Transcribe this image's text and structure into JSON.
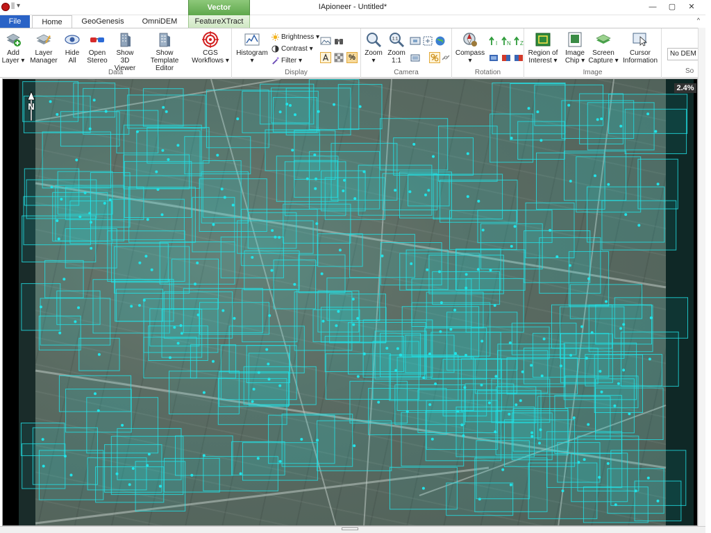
{
  "window": {
    "title": "IApioneer - Untitled*",
    "minimize": "—",
    "maximize": "▢",
    "close": "✕"
  },
  "quick_access": "|| ▾",
  "context_tab_group": "Vector",
  "tabs": [
    {
      "label": "File"
    },
    {
      "label": "Home"
    },
    {
      "label": "GeoGenesis"
    },
    {
      "label": "OmniDEM"
    },
    {
      "label": "FeatureXTract"
    }
  ],
  "ribbon_collapse": "^",
  "groups": {
    "data": {
      "label": "Data",
      "buttons": [
        {
          "l1": "Add",
          "l2": "Layer ▾"
        },
        {
          "l1": "Layer",
          "l2": "Manager"
        },
        {
          "l1": "Hide",
          "l2": "All"
        },
        {
          "l1": "Open",
          "l2": "Stereo"
        },
        {
          "l1": "Show 3D",
          "l2": "Viewer"
        },
        {
          "l1": "Show Template",
          "l2": "Editor"
        },
        {
          "l1": "CGS",
          "l2": "Workflows ▾"
        }
      ]
    },
    "display": {
      "label": "Display",
      "histogram": {
        "l1": "Histogram",
        "l2": "▾"
      },
      "brightness": "Brightness ▾",
      "contrast": "Contrast ▾",
      "filter": "Filter ▾",
      "percent": "%"
    },
    "camera": {
      "label": "Camera",
      "zoom": {
        "l1": "Zoom",
        "l2": "▾"
      },
      "zoom11": {
        "l1": "Zoom",
        "l2": "1:1"
      },
      "zoom11_icon": "1:1"
    },
    "rotation": {
      "label": "Rotation",
      "compass": {
        "l1": "Compass",
        "l2": "▾"
      }
    },
    "image": {
      "label": "Image",
      "buttons": [
        {
          "l1": "Region of",
          "l2": "Interest ▾"
        },
        {
          "l1": "Image",
          "l2": "Chip ▾"
        },
        {
          "l1": "Screen",
          "l2": "Capture ▾"
        },
        {
          "l1": "Cursor",
          "l2": "Information"
        }
      ]
    },
    "dem": {
      "select": "No DEM",
      "label_partial": "So"
    }
  },
  "viewport": {
    "zoom_level": "2.4%",
    "north_label": "N",
    "footprint_color": "#22e3e8"
  }
}
